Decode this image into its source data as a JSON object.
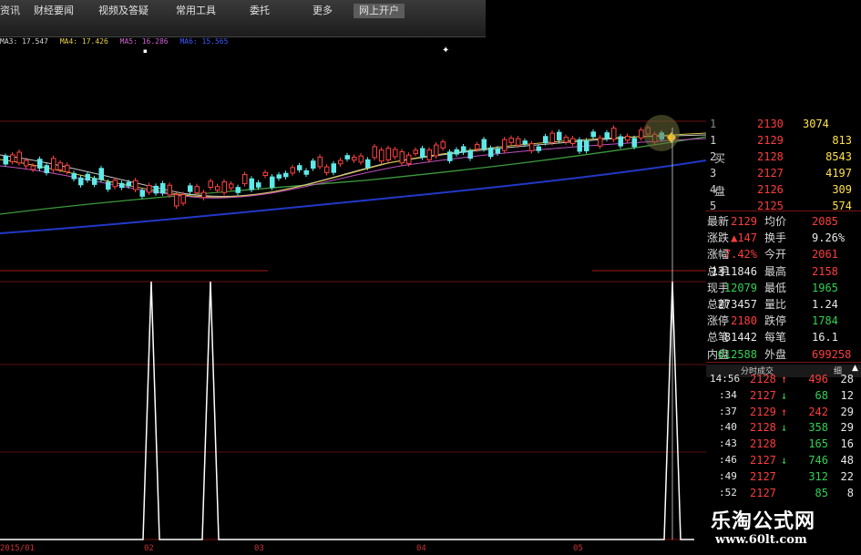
{
  "menu": {
    "items": [
      "资讯",
      "财经要闻",
      "视频及答疑",
      "常用工具",
      "委托",
      "更多",
      "网上开户"
    ]
  },
  "ma_legend": [
    {
      "label": "MA3: 17.547",
      "color": "#d8d8d8"
    },
    {
      "label": "MA4: 17.426",
      "color": "#e8d04a"
    },
    {
      "label": "MA5: 16.286",
      "color": "#d060d0"
    },
    {
      "label": "MA6: 15.565",
      "color": "#3b5bff"
    }
  ],
  "order_book": {
    "side_labels": [
      "买",
      "盘"
    ],
    "top_row": {
      "level": "1",
      "price": "2130",
      "volume": "3074"
    },
    "bids": [
      {
        "level": "1",
        "price": "2129",
        "volume": "813"
      },
      {
        "level": "2",
        "price": "2128",
        "volume": "8543"
      },
      {
        "level": "3",
        "price": "2127",
        "volume": "4197"
      },
      {
        "level": "4",
        "price": "2126",
        "volume": "309"
      },
      {
        "level": "5",
        "price": "2125",
        "volume": "574"
      }
    ]
  },
  "quote": [
    {
      "l1": "最新",
      "v1": "2129",
      "c1": "red",
      "l2": "均价",
      "v2": "2085",
      "c2": "red"
    },
    {
      "l1": "涨跌",
      "v1": "▲147",
      "c1": "red",
      "l2": "换手",
      "v2": "9.26%",
      "c2": "white"
    },
    {
      "l1": "涨幅",
      "v1": "7.42%",
      "c1": "red",
      "l2": "今开",
      "v2": "2061",
      "c2": "red"
    },
    {
      "l1": "总手",
      "v1": "1311846",
      "c1": "white",
      "l2": "最高",
      "v2": "2158",
      "c2": "red"
    },
    {
      "l1": "现手",
      "v1": "12079",
      "c1": "green",
      "l2": "最低",
      "v2": "1965",
      "c2": "green"
    },
    {
      "l1": "总额",
      "v1": "273457",
      "c1": "white",
      "l2": "量比",
      "v2": "1.24",
      "c2": "white"
    },
    {
      "l1": "涨停",
      "v1": "2180",
      "c1": "red",
      "l2": "跌停",
      "v2": "1784",
      "c2": "green"
    },
    {
      "l1": "总笔",
      "v1": "81442",
      "c1": "white",
      "l2": "每笔",
      "v2": "16.1",
      "c2": "white"
    },
    {
      "l1": "内盘",
      "v1": "612588",
      "c1": "green",
      "l2": "外盘",
      "v2": "699258",
      "c2": "red"
    }
  ],
  "ticks_header": {
    "title": "分时成交",
    "right": "细"
  },
  "ticks": [
    {
      "time": "14:56",
      "price": "2128",
      "dir": "↑",
      "dir_color": "red",
      "vol": "496",
      "vol_color": "red",
      "n": "28"
    },
    {
      "time": ":34",
      "price": "2127",
      "dir": "↓",
      "dir_color": "green",
      "vol": "68",
      "vol_color": "green",
      "n": "12"
    },
    {
      "time": ":37",
      "price": "2129",
      "dir": "↑",
      "dir_color": "red",
      "vol": "242",
      "vol_color": "red",
      "n": "29"
    },
    {
      "time": ":40",
      "price": "2128",
      "dir": "↓",
      "dir_color": "green",
      "vol": "358",
      "vol_color": "green",
      "n": "29"
    },
    {
      "time": ":43",
      "price": "2128",
      "dir": "",
      "dir_color": "red",
      "vol": "165",
      "vol_color": "green",
      "n": "16"
    },
    {
      "time": ":46",
      "price": "2127",
      "dir": "↓",
      "dir_color": "green",
      "vol": "746",
      "vol_color": "green",
      "n": "48"
    },
    {
      "time": ":49",
      "price": "2127",
      "dir": "",
      "dir_color": "red",
      "vol": "312",
      "vol_color": "green",
      "n": "22"
    },
    {
      "time": ":52",
      "price": "2127",
      "dir": "",
      "dir_color": "red",
      "vol": "85",
      "vol_color": "green",
      "n": "8"
    }
  ],
  "x_axis_labels": [
    "2015/01",
    "02",
    "03",
    "04",
    "05"
  ],
  "watermark": {
    "title": "乐淘公式网",
    "url": "www.60lt.com"
  },
  "colors": {
    "background": "#000000",
    "up": "#ff3c3c",
    "down": "#33d052",
    "grid": "#7a1515",
    "signal": "#ffffff"
  }
}
